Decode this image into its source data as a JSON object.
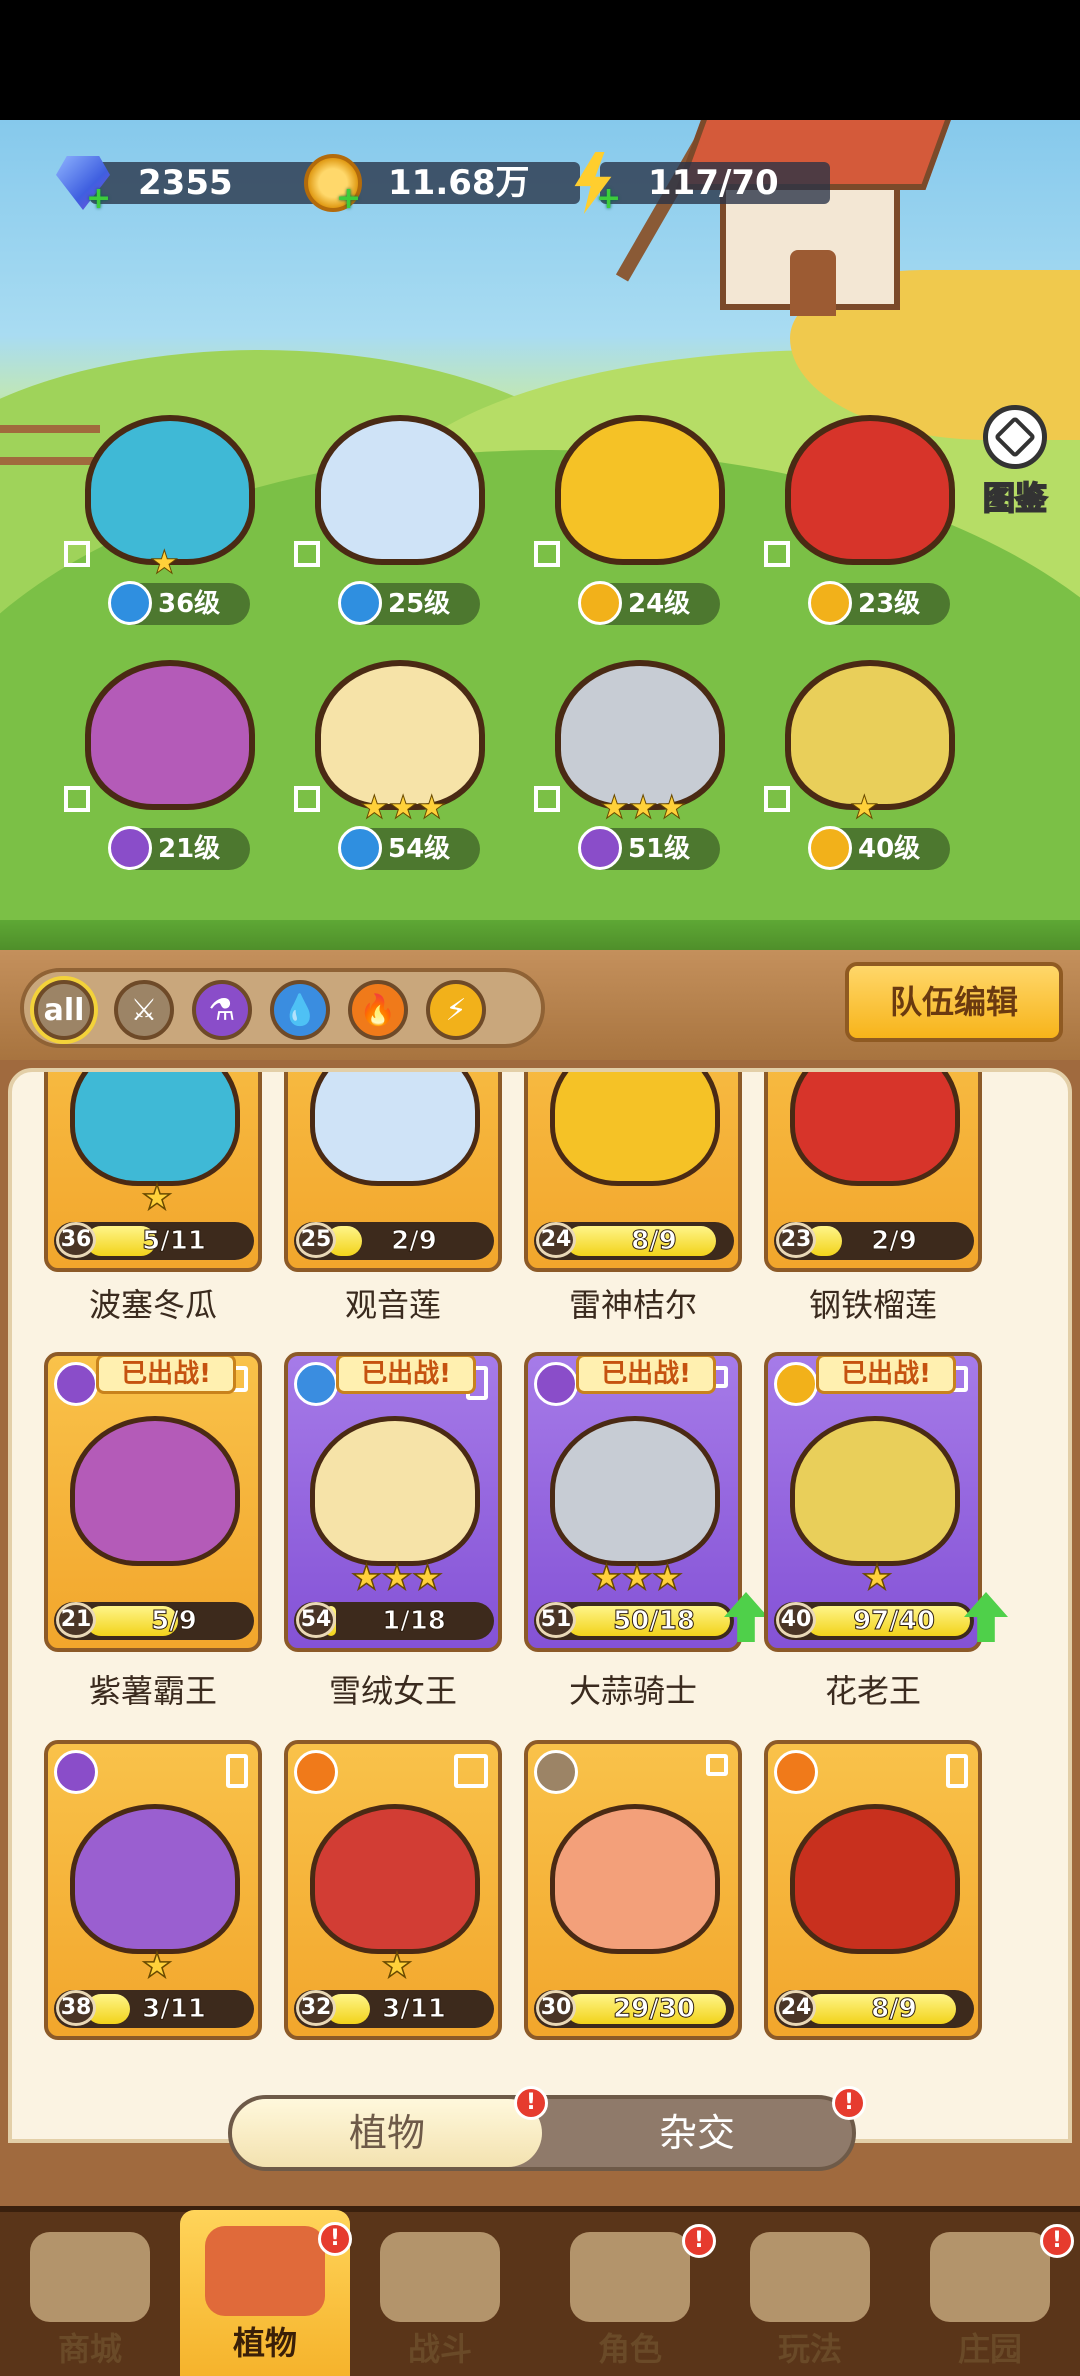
{
  "resources": {
    "gems": "2355",
    "coins": "11.68万",
    "energy": "117/70"
  },
  "pedia_label": "图鉴",
  "team": [
    {
      "level": "36级",
      "element": "water",
      "color": "#3fb9d6"
    },
    {
      "level": "25级",
      "element": "water",
      "color": "#cfe3f7"
    },
    {
      "level": "24级",
      "element": "lightning",
      "color": "#f5c226"
    },
    {
      "level": "23级",
      "element": "lightning",
      "color": "#d7342a"
    },
    {
      "level": "21级",
      "element": "poison",
      "color": "#b45bb8"
    },
    {
      "level": "54级",
      "element": "water",
      "color": "#f6e3a8"
    },
    {
      "level": "51级",
      "element": "poison",
      "color": "#c7ccd4"
    },
    {
      "level": "40级",
      "element": "lightning",
      "color": "#e9cf5a"
    }
  ],
  "filters": {
    "all": "all"
  },
  "team_edit": "队伍编辑",
  "cards_row1": [
    {
      "name": "波塞冬瓜",
      "level": "36",
      "count": "5/11",
      "fill": 0.45
    },
    {
      "name": "观音莲",
      "level": "25",
      "count": "2/9",
      "fill": 0.22
    },
    {
      "name": "雷神桔尔",
      "level": "24",
      "count": "8/9",
      "fill": 0.89
    },
    {
      "name": "钢铁榴莲",
      "level": "23",
      "count": "2/9",
      "fill": 0.22
    }
  ],
  "cards_row2": [
    {
      "name": "紫薯霸王",
      "level": "21",
      "count": "5/9",
      "fill": 0.56,
      "badge": "已出战!"
    },
    {
      "name": "雪绒女王",
      "level": "54",
      "count": "1/18",
      "fill": 0.06,
      "badge": "已出战!"
    },
    {
      "name": "大蒜骑士",
      "level": "51",
      "count": "50/18",
      "fill": 1.0,
      "badge": "已出战!"
    },
    {
      "name": "花老王",
      "level": "40",
      "count": "97/40",
      "fill": 1.0,
      "badge": "已出战!"
    }
  ],
  "cards_row3": [
    {
      "level": "38",
      "count": "3/11",
      "fill": 0.27
    },
    {
      "level": "32",
      "count": "3/11",
      "fill": 0.27
    },
    {
      "level": "30",
      "count": "29/30",
      "fill": 0.97
    },
    {
      "level": "24",
      "count": "8/9",
      "fill": 0.89
    }
  ],
  "subtabs": {
    "plants": "植物",
    "hybrid": "杂交"
  },
  "alert_mark": "!",
  "nav": {
    "shop": "商城",
    "plants": "植物",
    "battle": "战斗",
    "character": "角色",
    "play": "玩法",
    "manor": "庄园"
  }
}
